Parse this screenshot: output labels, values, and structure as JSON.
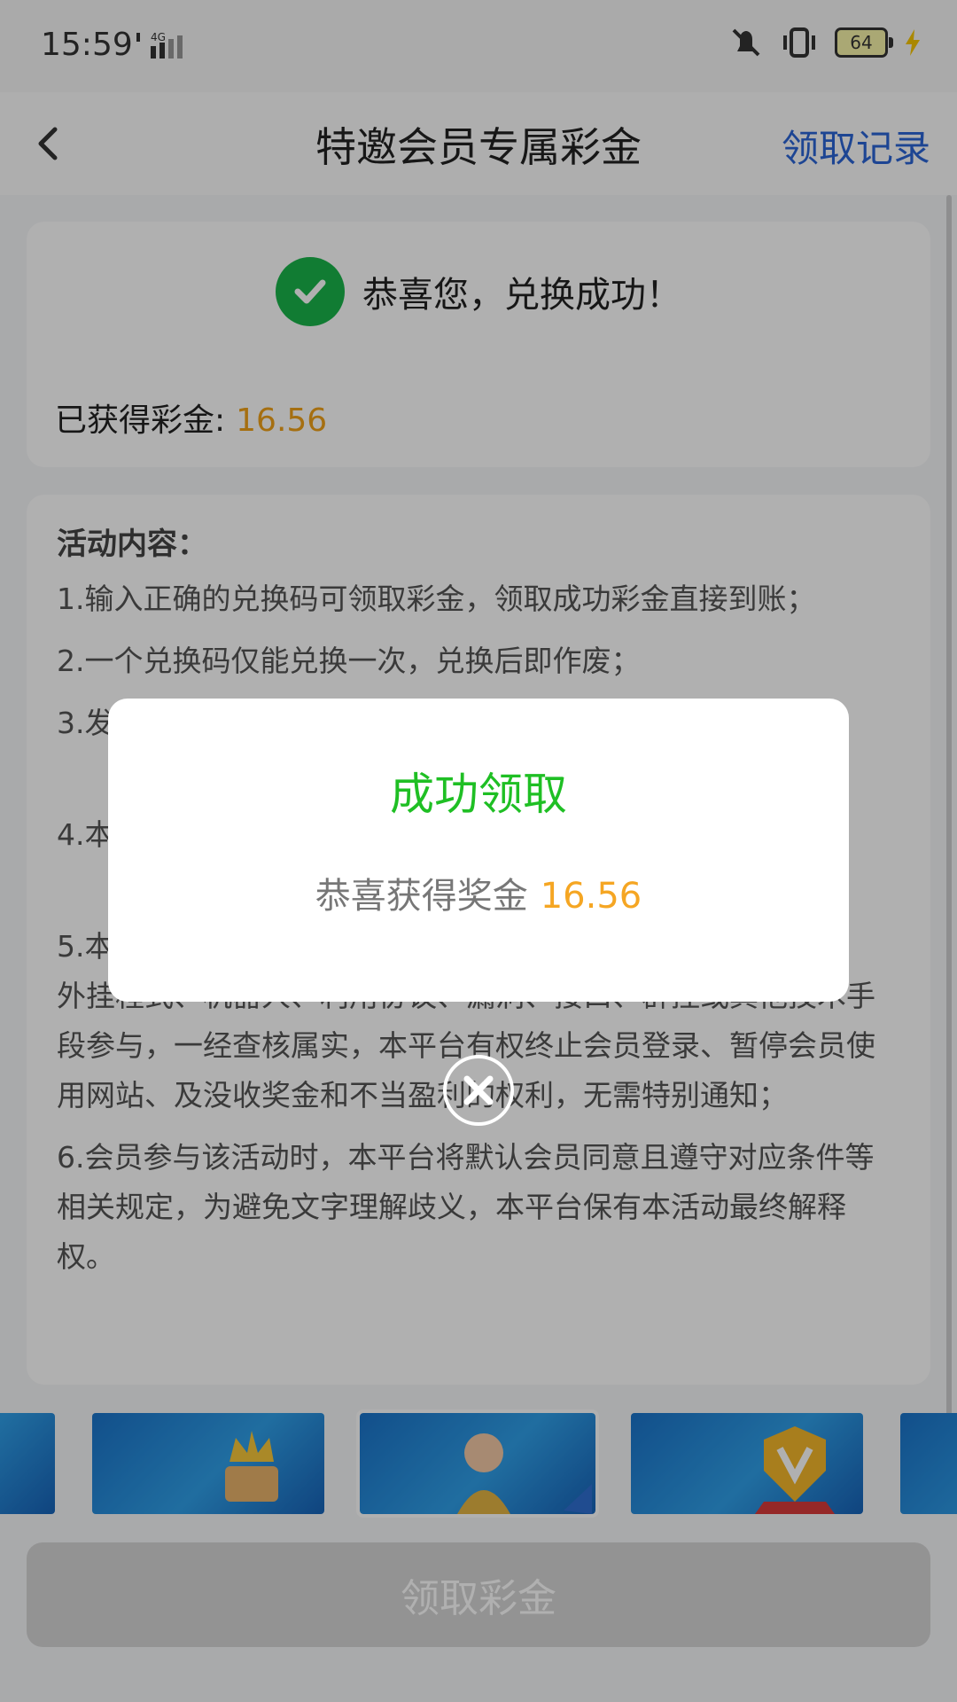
{
  "status_bar": {
    "time": "15:59",
    "network": "4G",
    "battery": "64",
    "icons": [
      "signal-icon",
      "mute-icon",
      "vibrate-icon",
      "battery-icon",
      "charging-icon"
    ]
  },
  "nav": {
    "back_icon": "chevron-left-icon",
    "title": "特邀会员专属彩金",
    "record_label": "领取记录"
  },
  "result_card": {
    "success_text": "恭喜您，兑换成功！",
    "earned_label": "已获得彩金:",
    "earned_value": "16.56"
  },
  "rules": {
    "heading": "活动内容：",
    "items": [
      "1.输入正确的兑换码可领取彩金，领取成功彩金直接到账；",
      "2.一个兑换码仅能兑换一次，兑换后即作废；",
      "3.发",
      "4.本",
      "5.本",
      "外挂程式、机器人、利用协议、漏洞、接口、群控或其他技术手段参与，一经查核属实，本平台有权终止会员登录、暂停会员使用网站、及没收奖金和不当盈利的权利，无需特别通知；",
      "6.会员参与该活动时，本平台将默认会员同意且遵守对应条件等相关规定，为避免文字理解歧义，本平台保有本活动最终解释权。"
    ]
  },
  "banners": [
    "banner-1",
    "banner-crown",
    "banner-girl",
    "banner-v-badge",
    "banner-5"
  ],
  "claim_button": "领取彩金",
  "modal": {
    "title": "成功领取",
    "text": "恭喜获得奖金",
    "amount": "16.56",
    "close_icon": "close-circle-icon"
  },
  "colors": {
    "accent_blue": "#2b64d6",
    "success_green": "#19b44a",
    "amount_orange": "#f0a11a",
    "modal_title_green": "#1fbf24"
  }
}
